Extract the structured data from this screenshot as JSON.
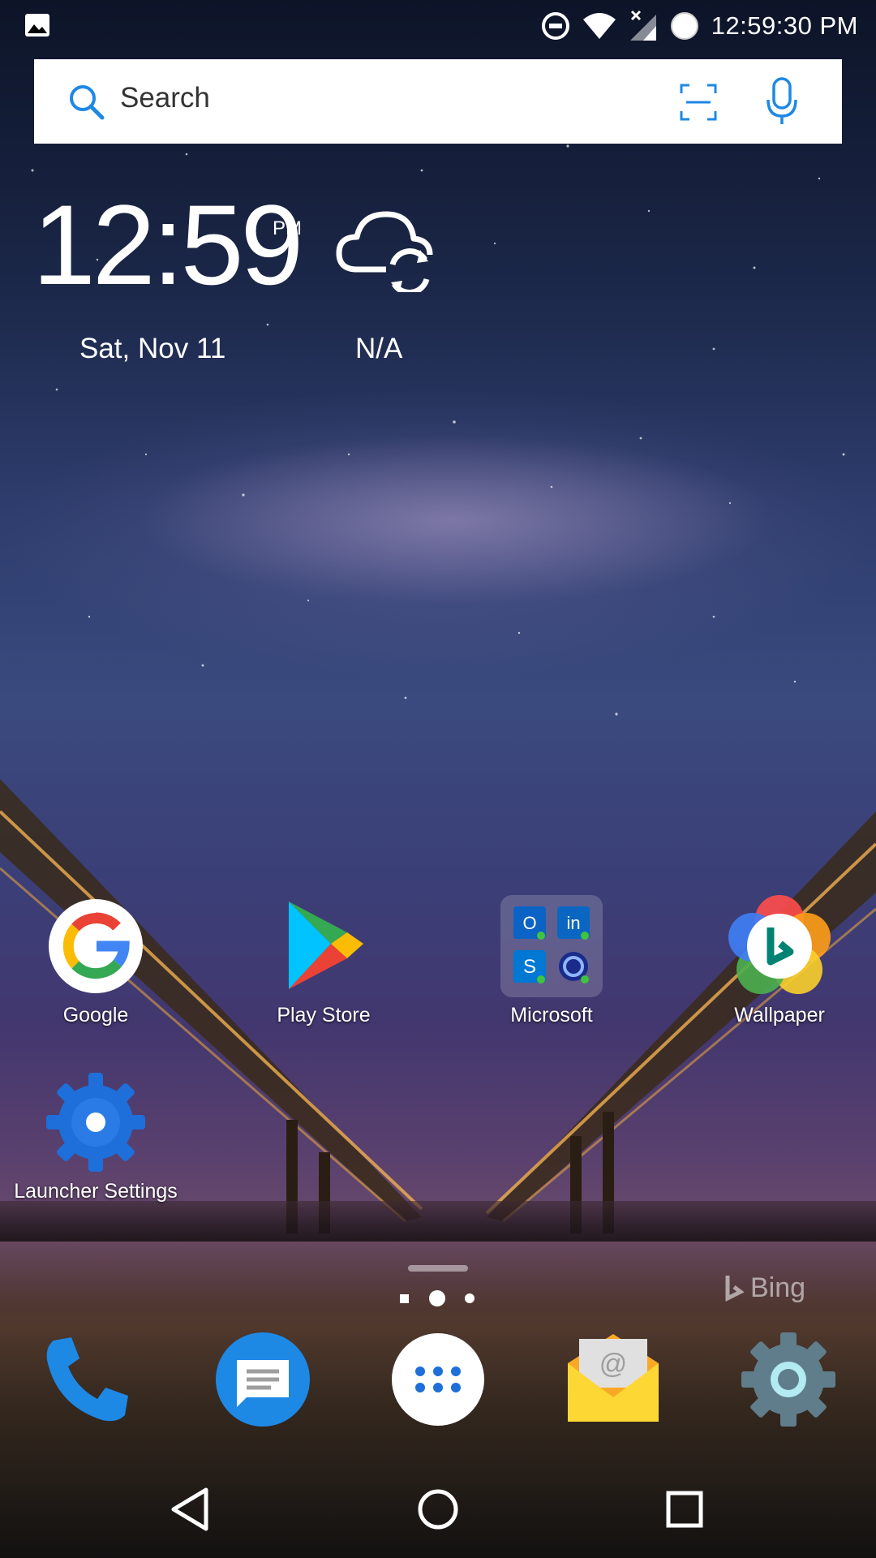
{
  "status_bar": {
    "time": "12:59:30 PM",
    "icons": [
      "image-notification-icon",
      "do-not-disturb-icon",
      "wifi-icon",
      "signal-no-data-icon",
      "battery-icon"
    ]
  },
  "search": {
    "placeholder": "Search",
    "icons": [
      "search-icon",
      "scan-icon",
      "microphone-icon"
    ]
  },
  "clock_widget": {
    "time": "12:59",
    "ampm": "PM",
    "date": "Sat, Nov 11"
  },
  "weather_widget": {
    "icon": "cloud-sync-icon",
    "text": "N/A"
  },
  "apps": [
    {
      "label": "Google",
      "icon": "google-icon"
    },
    {
      "label": "Play Store",
      "icon": "play-store-icon"
    },
    {
      "label": "Microsoft",
      "icon": "microsoft-folder-icon"
    },
    {
      "label": "Wallpaper",
      "icon": "bing-wallpaper-icon"
    },
    {
      "label": "Launcher Settings",
      "icon": "launcher-settings-icon"
    }
  ],
  "wallpaper_credit": "Bing",
  "page_indicator": {
    "pages": 3,
    "current": 2
  },
  "dock": [
    {
      "name": "phone",
      "icon": "phone-icon"
    },
    {
      "name": "messages",
      "icon": "messages-icon"
    },
    {
      "name": "app-drawer",
      "icon": "app-drawer-icon"
    },
    {
      "name": "email",
      "icon": "email-icon"
    },
    {
      "name": "settings",
      "icon": "settings-gear-icon"
    }
  ],
  "nav_bar": [
    "back-icon",
    "home-icon",
    "recents-icon"
  ],
  "colors": {
    "accent_blue": "#1565c0",
    "google_red": "#ea4335",
    "google_yellow": "#fbbc05",
    "google_green": "#34a853",
    "google_blue": "#4285f4"
  }
}
